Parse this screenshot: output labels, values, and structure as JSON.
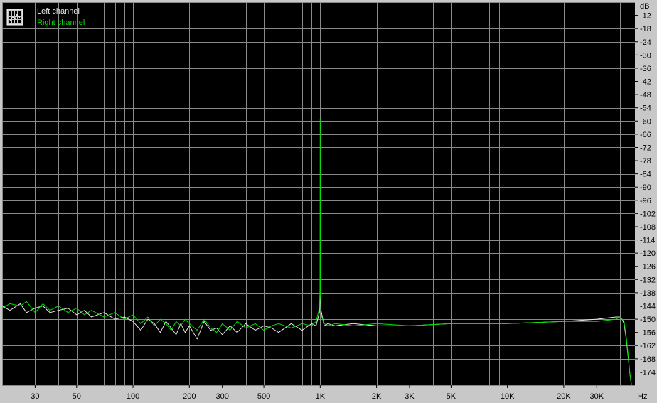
{
  "chart_data": {
    "type": "line",
    "title": "",
    "xlabel": "Hz",
    "ylabel": "dB",
    "x_scale": "log",
    "xlim": [
      20,
      48000
    ],
    "ylim": [
      -180,
      -6
    ],
    "grid": true,
    "legend_position": "top-left",
    "colors": {
      "background": "#000000",
      "grid": "#8a8a8a",
      "frame": "#c8c8c8",
      "left": "#e8e8e8",
      "right": "#00e000"
    },
    "x_ticks": [
      {
        "value": 30,
        "label": "30"
      },
      {
        "value": 50,
        "label": "50"
      },
      {
        "value": 100,
        "label": "100"
      },
      {
        "value": 200,
        "label": "200"
      },
      {
        "value": 300,
        "label": "300"
      },
      {
        "value": 500,
        "label": "500"
      },
      {
        "value": 1000,
        "label": "1K"
      },
      {
        "value": 2000,
        "label": "2K"
      },
      {
        "value": 3000,
        "label": "3K"
      },
      {
        "value": 5000,
        "label": "5K"
      },
      {
        "value": 10000,
        "label": "10K"
      },
      {
        "value": 20000,
        "label": "20K"
      },
      {
        "value": 30000,
        "label": "30K"
      }
    ],
    "y_ticks": [
      -12,
      -18,
      -24,
      -30,
      -36,
      -42,
      -48,
      -54,
      -60,
      -66,
      -72,
      -78,
      -84,
      -90,
      -96,
      -102,
      -108,
      -114,
      -120,
      -126,
      -132,
      -138,
      -144,
      -150,
      -156,
      -162,
      -168,
      -174
    ],
    "series": [
      {
        "name": "Left channel",
        "color": "#e8e8e8",
        "x": [
          20,
          22,
          25,
          27,
          30,
          33,
          36,
          40,
          45,
          50,
          55,
          60,
          70,
          80,
          90,
          100,
          110,
          120,
          130,
          140,
          150,
          160,
          170,
          180,
          190,
          200,
          220,
          240,
          260,
          280,
          300,
          330,
          360,
          400,
          450,
          500,
          550,
          600,
          700,
          800,
          900,
          950,
          990,
          1000,
          1010,
          1050,
          1100,
          1200,
          1500,
          2000,
          3000,
          5000,
          10000,
          20000,
          30000,
          38000,
          40000,
          41000,
          42000,
          43000,
          44000,
          45000,
          46000
        ],
        "y": [
          -144,
          -146,
          -143,
          -147,
          -145,
          -144,
          -147,
          -146,
          -145,
          -148,
          -146,
          -149,
          -147,
          -150,
          -149,
          -151,
          -155,
          -150,
          -152,
          -156,
          -151,
          -154,
          -157,
          -152,
          -156,
          -153,
          -159,
          -151,
          -155,
          -154,
          -157,
          -153,
          -156,
          -152,
          -155,
          -153,
          -154,
          -156,
          -152,
          -155,
          -152,
          -153,
          -147,
          -140,
          -146,
          -153,
          -152,
          -153,
          -152,
          -153,
          -153,
          -152,
          -152,
          -151,
          -150,
          -149,
          -149,
          -150,
          -152,
          -158,
          -166,
          -174,
          -180
        ]
      },
      {
        "name": "Right channel",
        "color": "#00e000",
        "x": [
          20,
          22,
          25,
          27,
          30,
          33,
          36,
          40,
          45,
          50,
          55,
          60,
          70,
          80,
          90,
          100,
          110,
          120,
          130,
          140,
          150,
          160,
          170,
          180,
          190,
          200,
          220,
          240,
          260,
          280,
          300,
          330,
          360,
          400,
          450,
          500,
          550,
          600,
          700,
          800,
          900,
          950,
          990,
          997,
          1000,
          1003,
          1010,
          1050,
          1100,
          1200,
          1500,
          2000,
          3000,
          5000,
          10000,
          20000,
          30000,
          38000,
          40000,
          41000,
          42000,
          43000,
          44000,
          45000,
          46000
        ],
        "y": [
          -145,
          -143,
          -144,
          -142,
          -147,
          -143,
          -146,
          -144,
          -147,
          -145,
          -148,
          -146,
          -149,
          -147,
          -150,
          -148,
          -152,
          -149,
          -153,
          -150,
          -152,
          -155,
          -151,
          -153,
          -150,
          -152,
          -155,
          -150,
          -154,
          -156,
          -152,
          -155,
          -151,
          -154,
          -152,
          -155,
          -153,
          -152,
          -154,
          -152,
          -153,
          -151,
          -145,
          -137,
          -59,
          -138,
          -148,
          -152,
          -153,
          -152,
          -153,
          -152,
          -153,
          -152,
          -152,
          -151,
          -151,
          -150,
          -149,
          -150,
          -151,
          -157,
          -165,
          -174,
          -180
        ]
      }
    ]
  }
}
